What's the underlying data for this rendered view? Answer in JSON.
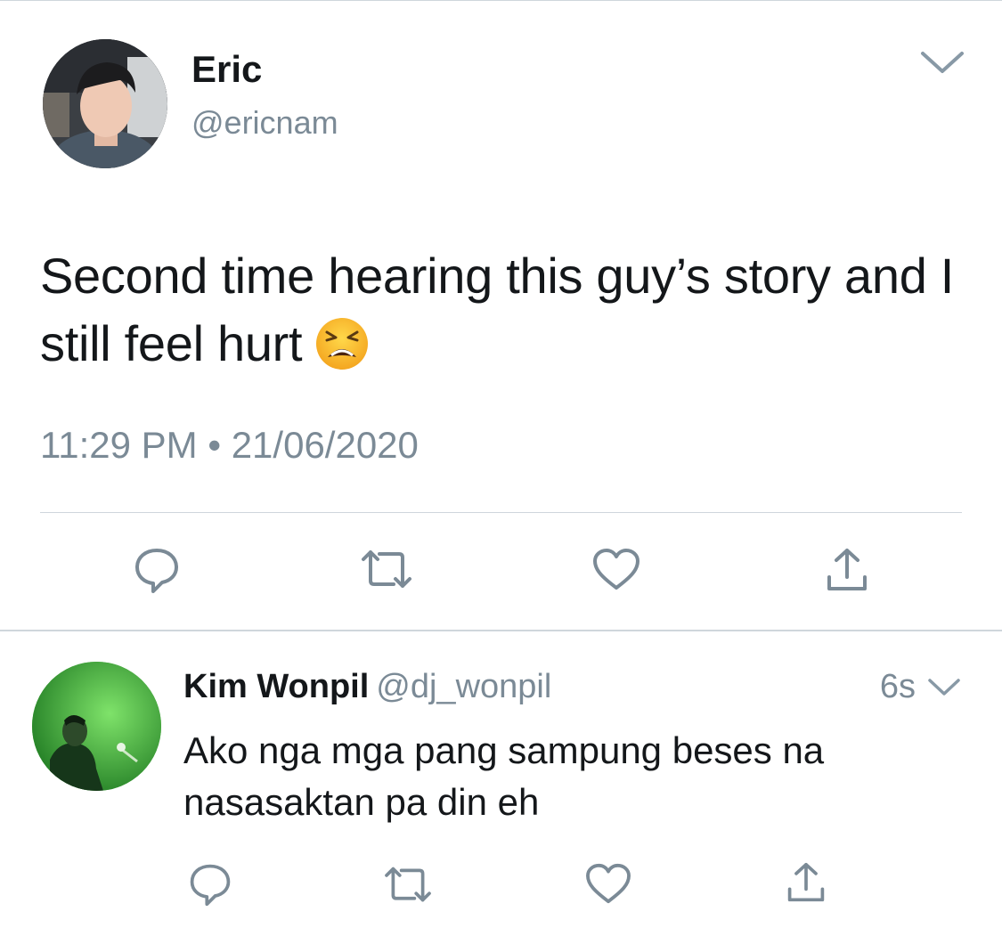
{
  "tweet": {
    "author_name": "Eric",
    "author_handle": "@ericnam",
    "text": "Second time hearing this guy’s story and I still feel hurt",
    "emoji": "weary-face",
    "timestamp": "11:29 PM • 21/06/2020"
  },
  "reply": {
    "author_name": "Kim Wonpil",
    "author_handle": "@dj_wonpil",
    "time": "6s",
    "text": "Ako nga mga pang sampung beses na nasasaktan pa din eh"
  },
  "actions": [
    "reply-icon",
    "retweet-icon",
    "like-icon",
    "share-icon"
  ],
  "colors": {
    "text": "#14171a",
    "secondary": "#7b8a96",
    "icon": "#7b8a96",
    "divider": "#cfd6dc"
  }
}
